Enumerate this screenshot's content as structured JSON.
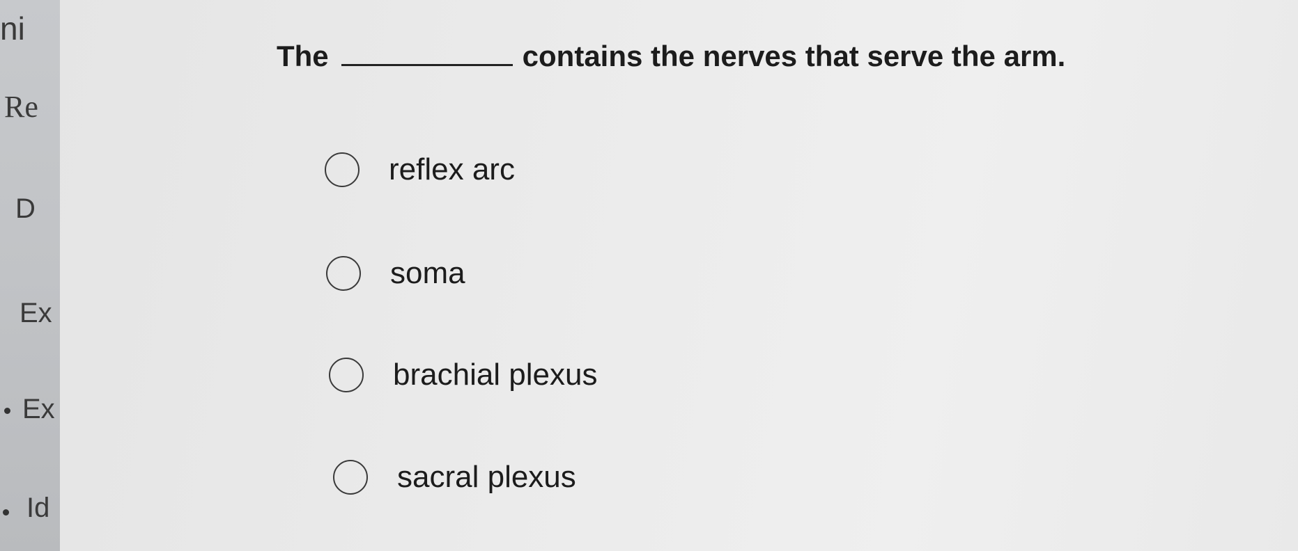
{
  "sidebar": {
    "items": [
      {
        "label": "ni"
      },
      {
        "label": "Re"
      },
      {
        "label": "D"
      },
      {
        "label": "Ex"
      },
      {
        "label": "Ex"
      },
      {
        "label": "Id"
      }
    ]
  },
  "question": {
    "before_blank": "The",
    "after_blank": "contains the nerves that serve the arm."
  },
  "options": [
    {
      "label": "reflex arc",
      "selected": false
    },
    {
      "label": "soma",
      "selected": false
    },
    {
      "label": "brachial plexus",
      "selected": false
    },
    {
      "label": "sacral plexus",
      "selected": false
    }
  ],
  "colors": {
    "sidebar": "#c1c3c6",
    "background": "#ebebeb",
    "text": "#1c1c1c"
  }
}
